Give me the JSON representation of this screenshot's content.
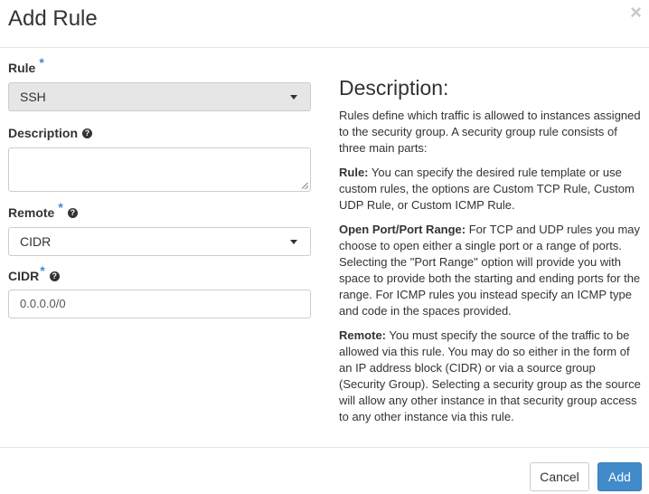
{
  "dialog": {
    "title": "Add Rule",
    "close_glyph": "×"
  },
  "form": {
    "rule": {
      "label": "Rule",
      "required_mark": "*",
      "value": "SSH"
    },
    "description": {
      "label": "Description",
      "help_glyph": "?",
      "value": ""
    },
    "remote": {
      "label": "Remote",
      "required_mark": "*",
      "help_glyph": "?",
      "value": "CIDR"
    },
    "cidr": {
      "label": "CIDR",
      "required_mark": "*",
      "help_glyph": "?",
      "placeholder": "0.0.0.0/0"
    }
  },
  "description_panel": {
    "title": "Description:",
    "intro": "Rules define which traffic is allowed to instances assigned to the security group. A security group rule consists of three main parts:",
    "rule_term": "Rule:",
    "rule_text": " You can specify the desired rule template or use custom rules, the options are Custom TCP Rule, Custom UDP Rule, or Custom ICMP Rule.",
    "port_term": "Open Port/Port Range:",
    "port_text": " For TCP and UDP rules you may choose to open either a single port or a range of ports. Selecting the \"Port Range\" option will provide you with space to provide both the starting and ending ports for the range. For ICMP rules you instead specify an ICMP type and code in the spaces provided.",
    "remote_term": "Remote:",
    "remote_text": " You must specify the source of the traffic to be allowed via this rule. You may do so either in the form of an IP address block (CIDR) or via a source group (Security Group). Selecting a security group as the source will allow any other instance in that security group access to any other instance via this rule."
  },
  "footer": {
    "cancel_label": "Cancel",
    "add_label": "Add"
  },
  "colors": {
    "accent": "#428bca",
    "disabled_bg": "#e6e6e6",
    "close": "#c8c8c8"
  },
  "icons": {
    "close": "close-icon",
    "help": "question-circle-icon",
    "caret": "chevron-down-icon"
  }
}
